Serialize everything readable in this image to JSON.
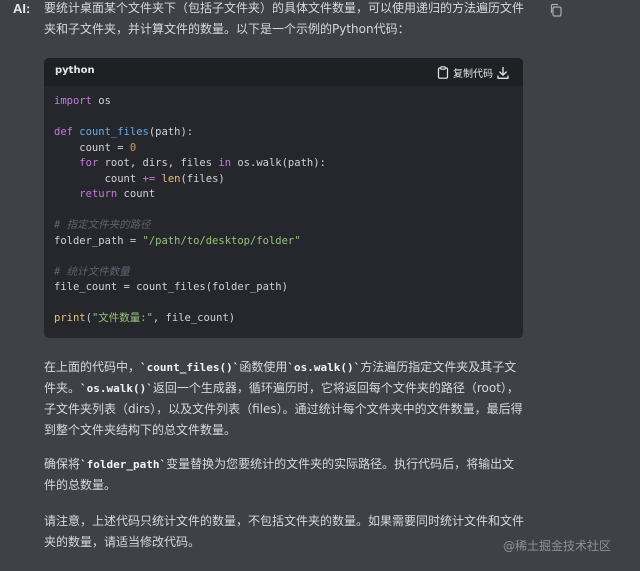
{
  "speaker": "AI:",
  "paragraphs": {
    "p1": "要统计桌面某个文件夹下（包括子文件夹）的具体文件数量，可以使用递归的方法遍历文件夹和子文件夹，并计算文件的数量。以下是一个示例的Python代码：",
    "p2_a": "在上面的代码中，",
    "p2_code1": "`count_files()`",
    "p2_b": "函数使用",
    "p2_code2": "`os.walk()`",
    "p2_c": "方法遍历指定文件夹及其子文件夹。",
    "p2_code3": "`os.walk()`",
    "p2_d": "返回一个生成器，循环遍历时，它将返回每个文件夹的路径（root），子文件夹列表（dirs），以及文件列表（files）。通过统计每个文件夹中的文件数量，最后得到整个文件夹结构下的总文件数量。",
    "p3_a": "确保将",
    "p3_code": "`folder_path`",
    "p3_b": "变量替换为您要统计的文件夹的实际路径。执行代码后，将输出文件的总数量。",
    "p4": "请注意，上述代码只统计文件的数量，不包括文件夹的数量。如果需要同时统计文件和文件夹的数量，请适当修改代码。"
  },
  "code_block": {
    "language": "python",
    "copy_label": "复制代码",
    "lines": {
      "l1_kw": "import",
      "l1_rest": " os",
      "l3_kw": "def",
      "l3_fn": "count_files",
      "l3_rest": "(path):",
      "l4_a": "    count = ",
      "l4_num": "0",
      "l5_kw1": "for",
      "l5_a": " root, dirs, files ",
      "l5_kw2": "in",
      "l5_b": " os.walk(path):",
      "l6_a": "        count ",
      "l6_op": "+=",
      "l6_sp": " ",
      "l6_bi": "len",
      "l6_b": "(files)",
      "l7_kw": "return",
      "l7_rest": " count",
      "l9_cm": "# 指定文件夹的路径",
      "l10_a": "folder_path = ",
      "l10_str": "\"/path/to/desktop/folder\"",
      "l12_cm": "# 统计文件数量",
      "l13": "file_count = count_files(folder_path)",
      "l15_bi": "print",
      "l15_a": "(",
      "l15_str": "\"文件数量:\"",
      "l15_b": ", file_count)"
    }
  },
  "watermark": "@稀土掘金技术社区",
  "icons": {
    "message_copy": "copy-icon",
    "code_copy": "clipboard-icon",
    "download": "download-icon"
  }
}
